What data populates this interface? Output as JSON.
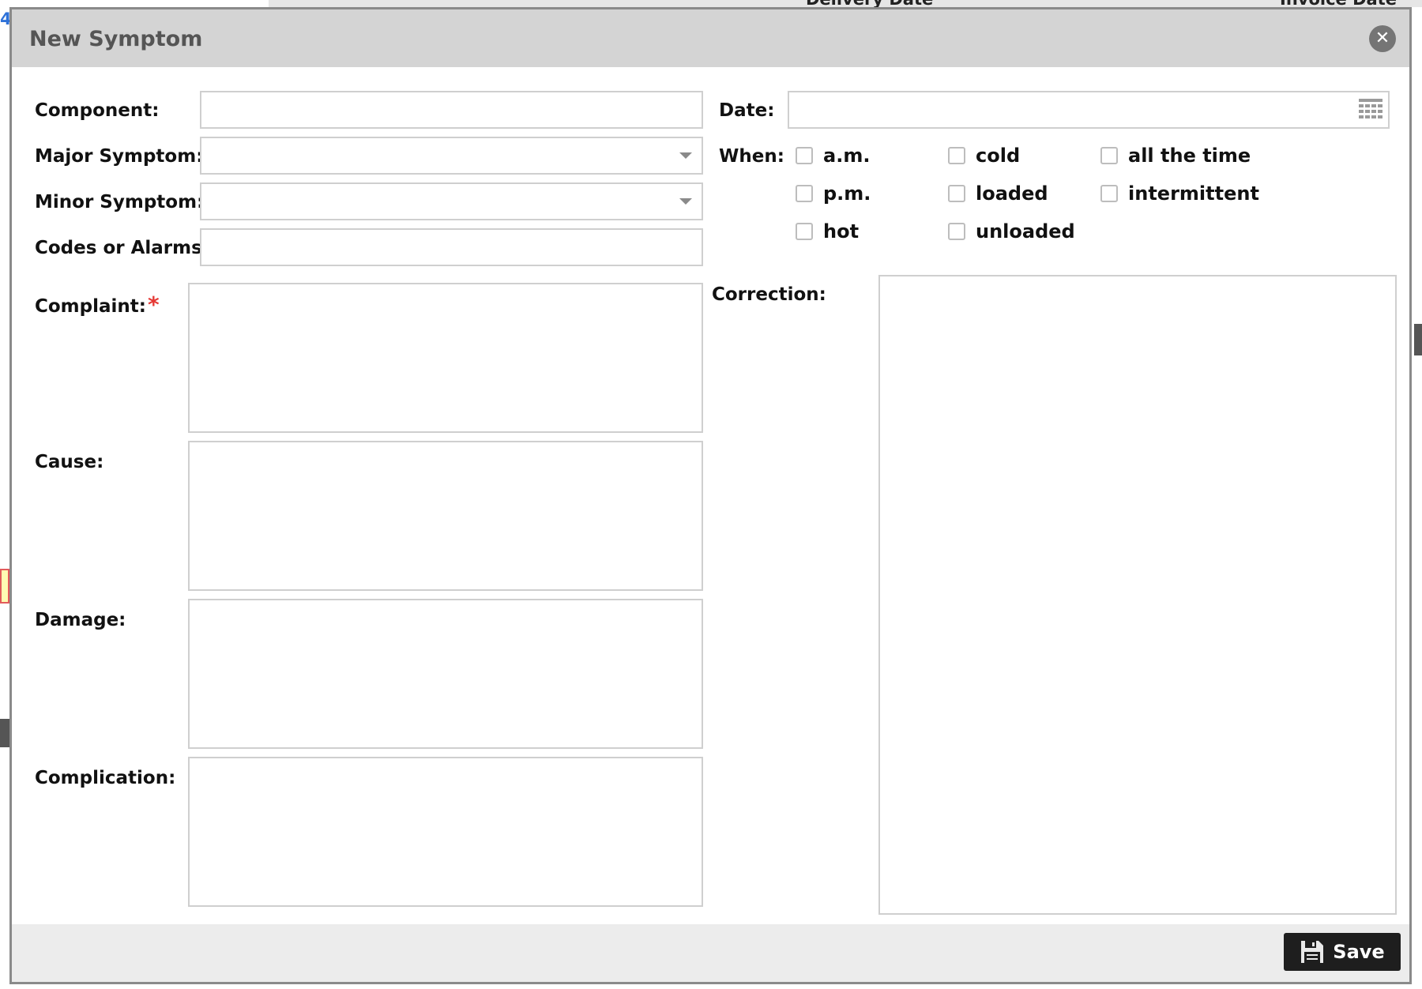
{
  "background": {
    "link_fragment": "4",
    "column_headers": [
      "Delivery Date",
      "Invoice Date"
    ]
  },
  "dialog": {
    "title": "New Symptom",
    "close_icon": "close-circle-icon",
    "fields": {
      "component": {
        "label": "Component:",
        "value": ""
      },
      "major_symptom": {
        "label": "Major Symptom:",
        "value": ""
      },
      "minor_symptom": {
        "label": "Minor Symptom:",
        "value": ""
      },
      "codes_alarms": {
        "label": "Codes or Alarms:",
        "value": ""
      },
      "date": {
        "label": "Date:",
        "value": "",
        "icon": "calendar-icon"
      },
      "complaint": {
        "label": "Complaint:",
        "required_mark": "*",
        "value": ""
      },
      "cause": {
        "label": "Cause:",
        "value": ""
      },
      "damage": {
        "label": "Damage:",
        "value": ""
      },
      "complication": {
        "label": "Complication:",
        "value": ""
      },
      "correction": {
        "label": "Correction:",
        "value": ""
      }
    },
    "when": {
      "label": "When:",
      "options": [
        {
          "label": "a.m.",
          "checked": false
        },
        {
          "label": "cold",
          "checked": false
        },
        {
          "label": "all the time",
          "checked": false
        },
        {
          "label": "p.m.",
          "checked": false
        },
        {
          "label": "loaded",
          "checked": false
        },
        {
          "label": "intermittent",
          "checked": false
        },
        {
          "label": "hot",
          "checked": false
        },
        {
          "label": "unloaded",
          "checked": false
        }
      ]
    },
    "footer": {
      "save_label": "Save",
      "save_icon": "floppy-disk-icon"
    }
  }
}
